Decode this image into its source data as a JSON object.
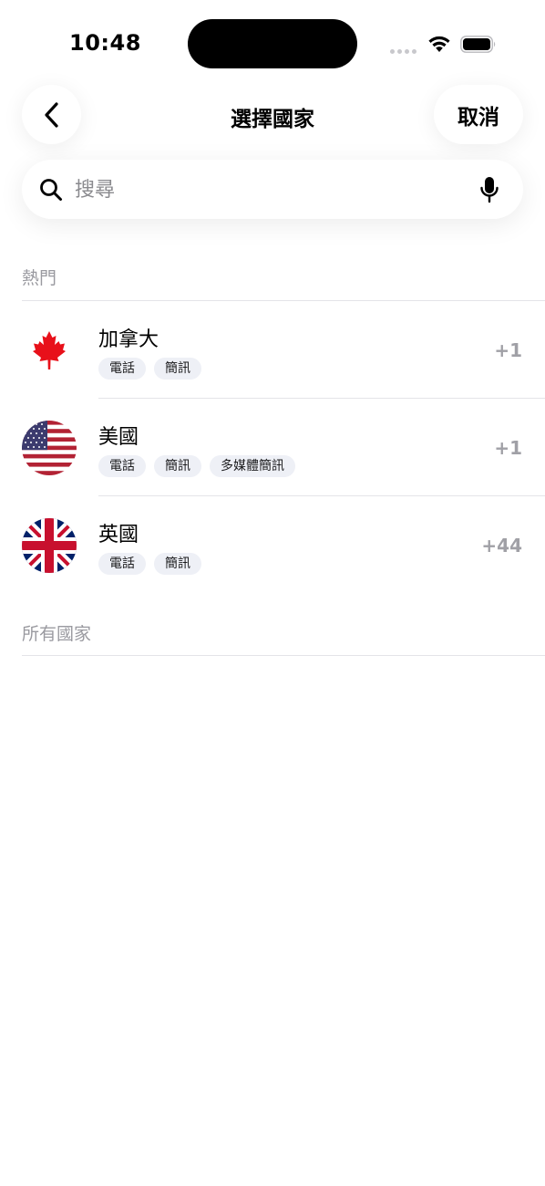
{
  "status_bar": {
    "time": "10:48"
  },
  "header": {
    "title": "選擇國家",
    "cancel_label": "取消",
    "back_icon": "chevron-left-icon"
  },
  "search": {
    "placeholder": "搜尋",
    "value": "",
    "icon": "search-icon",
    "mic_icon": "microphone-icon"
  },
  "sections": {
    "popular_label": "熱門",
    "all_label": "所有國家"
  },
  "countries": [
    {
      "name": "加拿大",
      "flag": "canada-flag-icon",
      "tags": [
        "電話",
        "簡訊"
      ],
      "code": "+1"
    },
    {
      "name": "美國",
      "flag": "usa-flag-icon",
      "tags": [
        "電話",
        "簡訊",
        "多媒體簡訊"
      ],
      "code": "+1"
    },
    {
      "name": "英國",
      "flag": "uk-flag-icon",
      "tags": [
        "電話",
        "簡訊"
      ],
      "code": "+44"
    }
  ],
  "colors": {
    "tag_bg": "#eef0f6",
    "muted_text": "#9a9aa0",
    "canada_red": "#e8101a",
    "usa_red": "#b22234",
    "usa_blue": "#3c3b6e",
    "uk_blue": "#012169",
    "uk_red": "#c8102e"
  }
}
